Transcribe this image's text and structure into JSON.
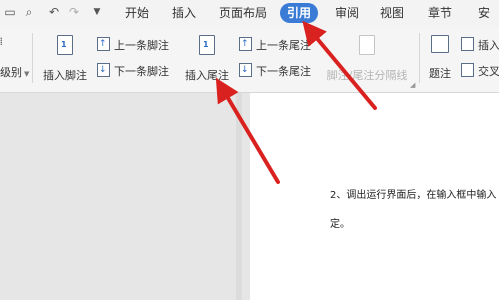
{
  "colors": {
    "accent": "#3a7bd5",
    "arrow": "#d9211f",
    "disabled_text": "#b5b5b5"
  },
  "quick_access": {
    "icons": [
      "file-icon",
      "search-preview-icon",
      "undo-icon",
      "redo-icon",
      "dropdown-icon"
    ]
  },
  "tabs": [
    {
      "label": "开始"
    },
    {
      "label": "插入"
    },
    {
      "label": "页面布局"
    },
    {
      "label": "引用",
      "active": true
    },
    {
      "label": "审阅"
    },
    {
      "label": "视图"
    },
    {
      "label": "章节"
    },
    {
      "label": "安"
    }
  ],
  "ribbon": {
    "left_partial_label": "级别",
    "insert_footnote": "插入脚注",
    "prev_footnote": "上一条脚注",
    "next_footnote": "下一条脚注",
    "insert_endnote": "插入尾注",
    "prev_endnote": "上一条尾注",
    "next_endnote": "下一条尾注",
    "separator_disabled": "脚注/尾注分隔线",
    "caption": "题注",
    "insert_partial": "插入",
    "cross_ref_partial": "交叉"
  },
  "document": {
    "line1": "2、调出运行界面后，在输入框中输入",
    "line2": "定。"
  }
}
